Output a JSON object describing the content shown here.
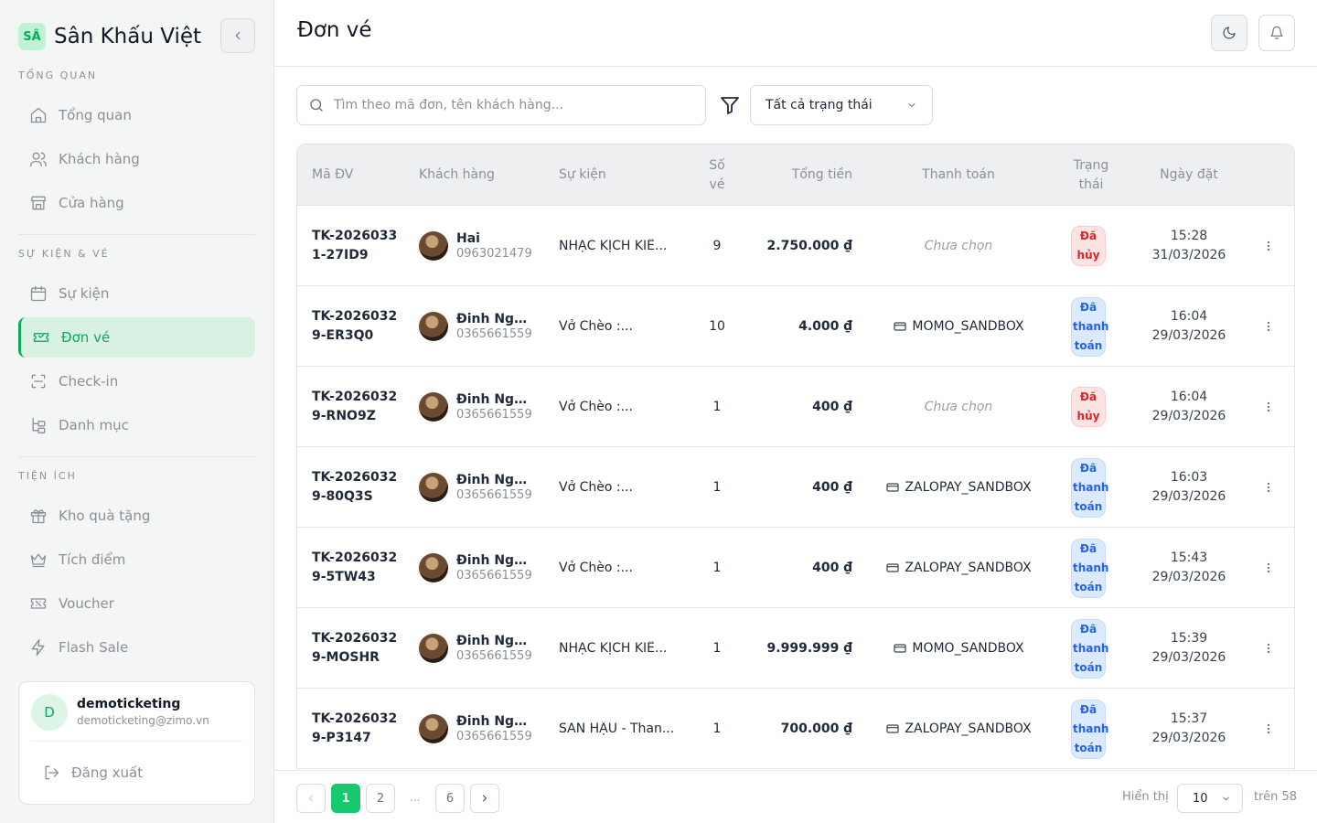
{
  "brand": {
    "logo": "SÂ",
    "name": "Sân Khấu Việt"
  },
  "sidebar": {
    "sections": [
      {
        "title": "TỔNG QUAN",
        "items": [
          {
            "label": "Tổng quan",
            "icon": "home-icon"
          },
          {
            "label": "Khách hàng",
            "icon": "users-icon"
          },
          {
            "label": "Cửa hàng",
            "icon": "store-icon"
          }
        ]
      },
      {
        "title": "SỰ KIỆN & VÉ",
        "items": [
          {
            "label": "Sự kiện",
            "icon": "calendar-icon"
          },
          {
            "label": "Đơn vé",
            "icon": "ticket-icon",
            "active": true
          },
          {
            "label": "Check-in",
            "icon": "scan-icon"
          },
          {
            "label": "Danh mục",
            "icon": "category-tree-icon"
          }
        ]
      },
      {
        "title": "TIỆN ÍCH",
        "items": [
          {
            "label": "Kho quà tặng",
            "icon": "gift-icon"
          },
          {
            "label": "Tích điểm",
            "icon": "crown-icon"
          },
          {
            "label": "Voucher",
            "icon": "voucher-icon"
          },
          {
            "label": "Flash Sale",
            "icon": "lightning-icon"
          }
        ]
      }
    ]
  },
  "user": {
    "initial": "D",
    "name": "demoticketing",
    "email": "demoticketing@zimo.vn",
    "logout_label": "Đăng xuất"
  },
  "header": {
    "title": "Đơn vé"
  },
  "toolbar": {
    "search_placeholder": "Tìm theo mã đơn, tên khách hàng...",
    "status_filter": "Tất cả trạng thái"
  },
  "table": {
    "columns": [
      "Mã ĐV",
      "Khách hàng",
      "Sự kiện",
      "Số vé",
      "Tổng tiền",
      "Thanh toán",
      "Trạng thái",
      "Ngày đặt"
    ],
    "rows": [
      {
        "code": "TK-20260331-27ID9",
        "customer": "Hai",
        "phone": "0963021479",
        "event": "NHẠC KỊCH KIẾ...",
        "qty": "9",
        "total": "2.750.000 ₫",
        "payment": "Chưa chọn",
        "payment_set": false,
        "status": "Đã hủy",
        "status_type": "cancel",
        "time": "15:28",
        "date": "31/03/2026"
      },
      {
        "code": "TK-20260329-ER3Q0",
        "customer": "Đinh Ngọ...",
        "phone": "0365661559",
        "event": "Vở Chèo :...",
        "qty": "10",
        "total": "4.000 ₫",
        "payment": "MOMO_SANDBOX",
        "payment_set": true,
        "status": "Đã thanh toán",
        "status_type": "paid",
        "time": "16:04",
        "date": "29/03/2026"
      },
      {
        "code": "TK-20260329-RNO9Z",
        "customer": "Đinh Ngọ...",
        "phone": "0365661559",
        "event": "Vở Chèo :...",
        "qty": "1",
        "total": "400 ₫",
        "payment": "Chưa chọn",
        "payment_set": false,
        "status": "Đã hủy",
        "status_type": "cancel",
        "time": "16:04",
        "date": "29/03/2026"
      },
      {
        "code": "TK-20260329-80Q3S",
        "customer": "Đinh Ngọ...",
        "phone": "0365661559",
        "event": "Vở Chèo :...",
        "qty": "1",
        "total": "400 ₫",
        "payment": "ZALOPAY_SANDBOX",
        "payment_set": true,
        "status": "Đã thanh toán",
        "status_type": "paid",
        "time": "16:03",
        "date": "29/03/2026"
      },
      {
        "code": "TK-20260329-5TW43",
        "customer": "Đinh Ngọ...",
        "phone": "0365661559",
        "event": "Vở Chèo :...",
        "qty": "1",
        "total": "400 ₫",
        "payment": "ZALOPAY_SANDBOX",
        "payment_set": true,
        "status": "Đã thanh toán",
        "status_type": "paid",
        "time": "15:43",
        "date": "29/03/2026"
      },
      {
        "code": "TK-20260329-MOSHR",
        "customer": "Đinh Ngọ...",
        "phone": "0365661559",
        "event": "NHẠC KỊCH KIẾ...",
        "qty": "1",
        "total": "9.999.999 ₫",
        "payment": "MOMO_SANDBOX",
        "payment_set": true,
        "status": "Đã thanh toán",
        "status_type": "paid",
        "time": "15:39",
        "date": "29/03/2026"
      },
      {
        "code": "TK-20260329-P3147",
        "customer": "Đinh Ngọ...",
        "phone": "0365661559",
        "event": "SAN HẬU - Than...",
        "qty": "1",
        "total": "700.000 ₫",
        "payment": "ZALOPAY_SANDBOX",
        "payment_set": true,
        "status": "Đã thanh toán",
        "status_type": "paid",
        "time": "15:37",
        "date": "29/03/2026"
      }
    ]
  },
  "pagination": {
    "pages": [
      "1",
      "2",
      "...",
      "6"
    ],
    "current": "1",
    "show_label": "Hiển thị",
    "page_size": "10",
    "total_label": "trên 58"
  },
  "colors": {
    "accent": "#16c86e",
    "accent_dark": "#11a85a",
    "cancel": "#dc2626",
    "paid": "#2563eb"
  }
}
